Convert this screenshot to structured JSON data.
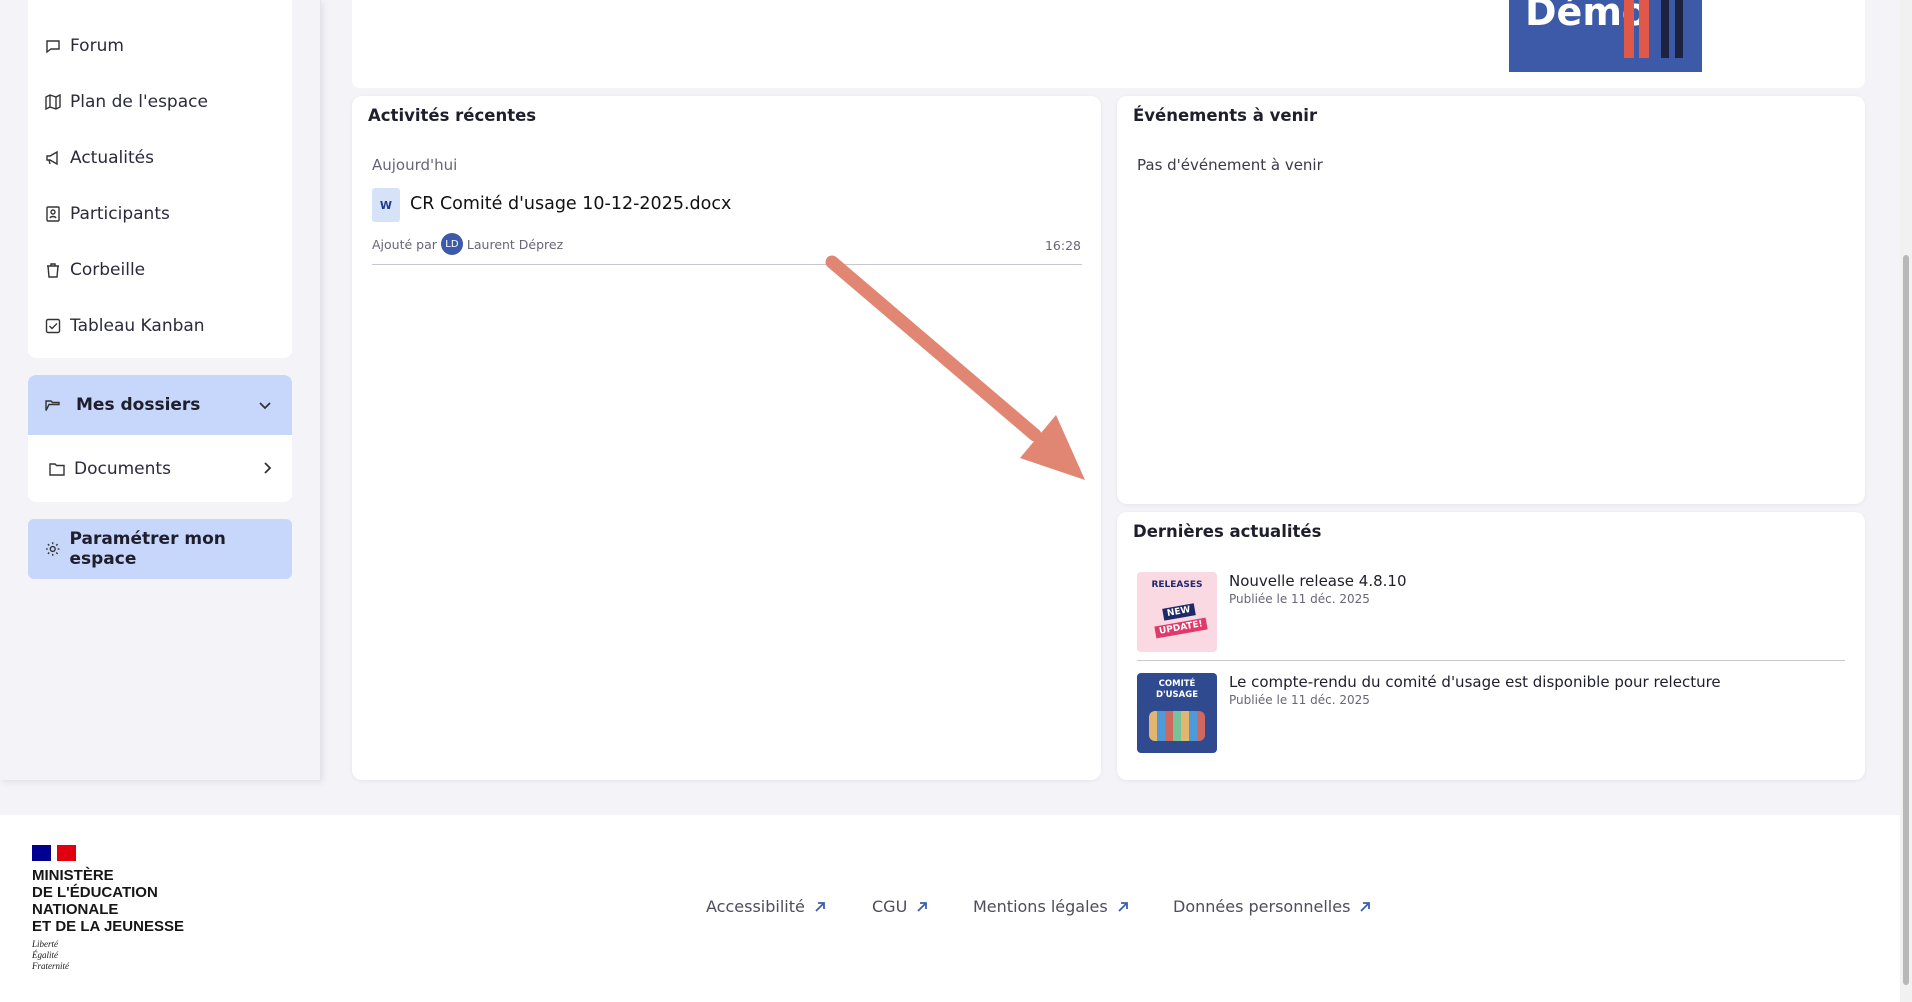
{
  "sidebar": {
    "items": [
      {
        "label": "Forum",
        "icon": "forum-icon"
      },
      {
        "label": "Plan de l'espace",
        "icon": "map-icon"
      },
      {
        "label": "Actualités",
        "icon": "megaphone-icon"
      },
      {
        "label": "Participants",
        "icon": "contacts-icon"
      },
      {
        "label": "Corbeille",
        "icon": "trash-icon"
      },
      {
        "label": "Tableau Kanban",
        "icon": "checkbox-icon"
      }
    ],
    "folders": {
      "title": "Mes dossiers",
      "documents": "Documents"
    },
    "settings_button": "Paramétrer mon espace"
  },
  "banner": {
    "text": "Démo"
  },
  "recent": {
    "title": "Activités récentes",
    "day": "Aujourd'hui",
    "file_badge": "W",
    "file_name": "CR Comité d'usage 10-12-2025.docx",
    "added_by": "Ajouté par",
    "avatar_initials": "LD",
    "author": "Laurent Déprez",
    "time": "16:28"
  },
  "events": {
    "title": "Événements à venir",
    "empty": "Pas d'événement à venir"
  },
  "news": {
    "title": "Dernières actualités",
    "items": [
      {
        "title": "Nouvelle release 4.8.10",
        "date": "Publiée le 11 déc. 2025",
        "thumb_top": "RELEASES",
        "thumb_badge1": "NEW",
        "thumb_badge2": "UPDATE!"
      },
      {
        "title": "Le compte-rendu du comité d'usage est disponible pour relecture",
        "date": "Publiée le 11 déc. 2025",
        "thumb_top": "COMITÉ",
        "thumb_top2": "D'USAGE"
      }
    ]
  },
  "footer": {
    "ministry": [
      "MINISTÈRE",
      "DE L'ÉDUCATION",
      "NATIONALE",
      "ET DE LA JEUNESSE"
    ],
    "motto": [
      "Liberté",
      "Égalité",
      "Fraternité"
    ],
    "links": [
      "Accessibilité",
      "CGU",
      "Mentions légales",
      "Données personnelles"
    ]
  },
  "colors": {
    "accent_light": "#c7d6fb",
    "annotation_arrow": "#e28674",
    "banner_blue": "#3d5aa8",
    "link_arrow": "#3a5fb0"
  }
}
